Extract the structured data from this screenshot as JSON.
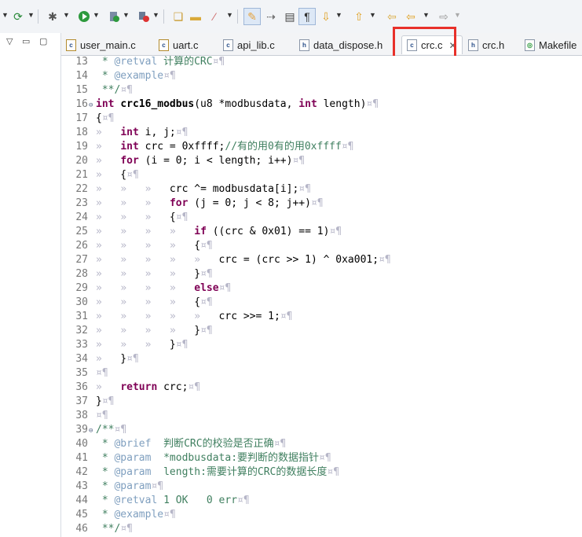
{
  "toolbar": {
    "icons": [
      "debug-run-icon",
      "gear-icon",
      "play-icon",
      "debug-icon",
      "external-tools-icon",
      "open-folder-icon",
      "folder-icon",
      "wand-icon",
      "pen-icon",
      "next-annotation-icon",
      "block-select-icon",
      "show-whitespace-icon",
      "down-arrow-icon",
      "up-arrow-icon",
      "back-icon",
      "forward-icon",
      "forward-disabled-icon"
    ]
  },
  "tabs": [
    {
      "label": "user_main.c",
      "icon": "c-file-icon"
    },
    {
      "label": "uart.c",
      "icon": "c-file-icon"
    },
    {
      "label": "api_lib.c",
      "icon": "c-file-icon"
    },
    {
      "label": "data_dispose.h",
      "icon": "h-file-icon"
    },
    {
      "label": "crc.c",
      "icon": "c-file-icon",
      "active": true
    },
    {
      "label": "crc.h",
      "icon": "h-file-icon"
    },
    {
      "label": "Makefile",
      "icon": "makefile-icon"
    }
  ],
  "colors": {
    "highlight": "#e8302a",
    "keyword": "#7f0055",
    "comment": "#3f7f5f",
    "doc_tag": "#7f9fbf"
  },
  "code_lines": [
    {
      "n": "13",
      "text": " * @retval 计算的CRC¤¶"
    },
    {
      "n": "14",
      "text": " * @example¤¶"
    },
    {
      "n": "15",
      "text": " **/¤¶"
    },
    {
      "n": "16",
      "text": "int crc16_modbus(u8 *modbusdata, int length)¤¶",
      "fold": true
    },
    {
      "n": "17",
      "text": "{¤¶"
    },
    {
      "n": "18",
      "text": "»   int i, j;¤¶"
    },
    {
      "n": "19",
      "text": "»   int crc = 0xffff;//有的用0有的用0xffff¤¶"
    },
    {
      "n": "20",
      "text": "»   for (i = 0; i < length; i++)¤¶"
    },
    {
      "n": "21",
      "text": "»   {¤¶"
    },
    {
      "n": "22",
      "text": "»   »   »   crc ^= modbusdata[i];¤¶"
    },
    {
      "n": "23",
      "text": "»   »   »   for (j = 0; j < 8; j++)¤¶"
    },
    {
      "n": "24",
      "text": "»   »   »   {¤¶"
    },
    {
      "n": "25",
      "text": "»   »   »   »   if ((crc & 0x01) == 1)¤¶"
    },
    {
      "n": "26",
      "text": "»   »   »   »   {¤¶"
    },
    {
      "n": "27",
      "text": "»   »   »   »   »   crc = (crc >> 1) ^ 0xa001;¤¶"
    },
    {
      "n": "28",
      "text": "»   »   »   »   }¤¶"
    },
    {
      "n": "29",
      "text": "»   »   »   »   else¤¶"
    },
    {
      "n": "30",
      "text": "»   »   »   »   {¤¶"
    },
    {
      "n": "31",
      "text": "»   »   »   »   »   crc >>= 1;¤¶"
    },
    {
      "n": "32",
      "text": "»   »   »   »   }¤¶"
    },
    {
      "n": "33",
      "text": "»   »   »   }¤¶"
    },
    {
      "n": "34",
      "text": "»   }¤¶"
    },
    {
      "n": "35",
      "text": "¤¶"
    },
    {
      "n": "36",
      "text": "»   return crc;¤¶"
    },
    {
      "n": "37",
      "text": "}¤¶"
    },
    {
      "n": "38",
      "text": "¤¶"
    },
    {
      "n": "39",
      "text": "/**¤¶",
      "fold": true
    },
    {
      "n": "40",
      "text": " * @brief  判断CRC的校验是否正确¤¶"
    },
    {
      "n": "41",
      "text": " * @param  *modbusdata:要判断的数据指针¤¶"
    },
    {
      "n": "42",
      "text": " * @param  length:需要计算的CRC的数据长度¤¶"
    },
    {
      "n": "43",
      "text": " * @param¤¶"
    },
    {
      "n": "44",
      "text": " * @retval 1 OK   0 err¤¶"
    },
    {
      "n": "45",
      "text": " * @example¤¶"
    },
    {
      "n": "46",
      "text": " **/¤¶"
    }
  ]
}
